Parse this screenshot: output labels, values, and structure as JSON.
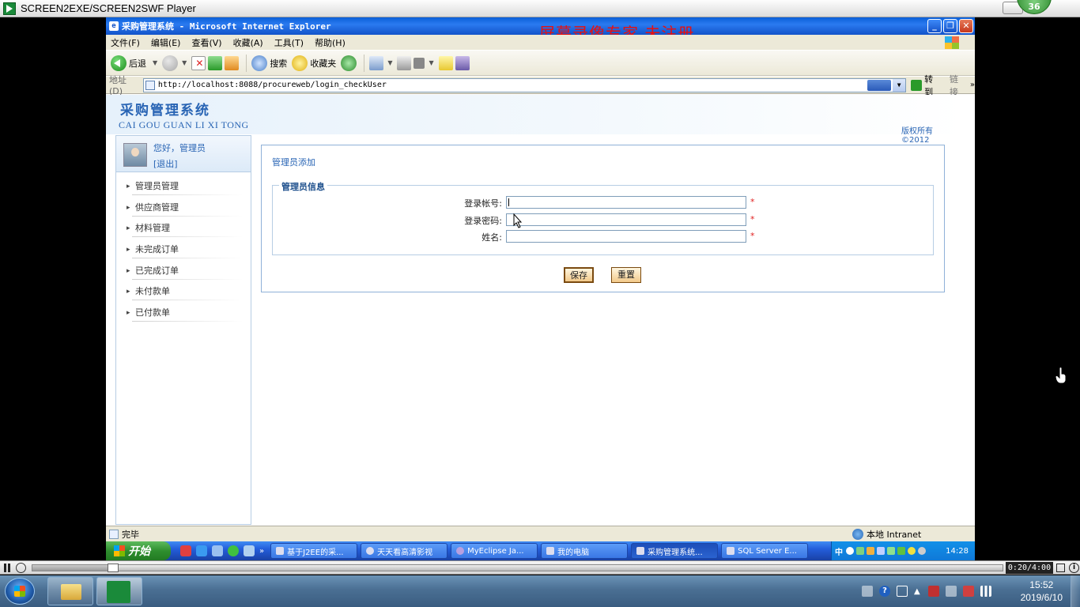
{
  "player": {
    "title": "SCREEN2EXE/SCREEN2SWF Player",
    "badge": "36",
    "time": "0:20/4:00",
    "progress_fraction": 0.083
  },
  "ie": {
    "window_title": "采购管理系统 - Microsoft Internet Explorer",
    "watermark": "屏幕录像专家  未注册",
    "menu": [
      "文件(F)",
      "编辑(E)",
      "查看(V)",
      "收藏(A)",
      "工具(T)",
      "帮助(H)"
    ],
    "toolbar": {
      "back": "后退",
      "search": "搜索",
      "favorites": "收藏夹"
    },
    "address_label": "地址(D)",
    "url": "http://localhost:8088/procureweb/login_checkUser",
    "go": "转到",
    "links": "链接",
    "status": "完毕",
    "zone": "本地 Intranet"
  },
  "site": {
    "title": "采购管理系统",
    "pinyin": "CAI GOU GUAN LI XI TONG",
    "copyright": "版权所有",
    "year": "©2012",
    "greeting": "您好，管理员",
    "logout": "[退出]",
    "nav": [
      "管理员管理",
      "供应商管理",
      "材料管理",
      "未完成订单",
      "已完成订单",
      "未付款单",
      "已付款单"
    ]
  },
  "form": {
    "panel_title": "管理员添加",
    "legend": "管理员信息",
    "fields": [
      {
        "label": "登录帐号:",
        "value": "",
        "required": "*"
      },
      {
        "label": "登录密码:",
        "value": "",
        "required": "*"
      },
      {
        "label": "姓名:",
        "value": "",
        "required": "*"
      }
    ],
    "save": "保存",
    "reset": "重置"
  },
  "xp_taskbar": {
    "start": "开始",
    "tasks": [
      "基于J2EE的采...",
      "天天看高清影视",
      "MyEclipse Ja...",
      "我的电脑",
      "采购管理系统...",
      "SQL Server E..."
    ],
    "ime": "中",
    "clock": "14:28"
  },
  "win7": {
    "time": "15:52",
    "date": "2019/6/10"
  }
}
